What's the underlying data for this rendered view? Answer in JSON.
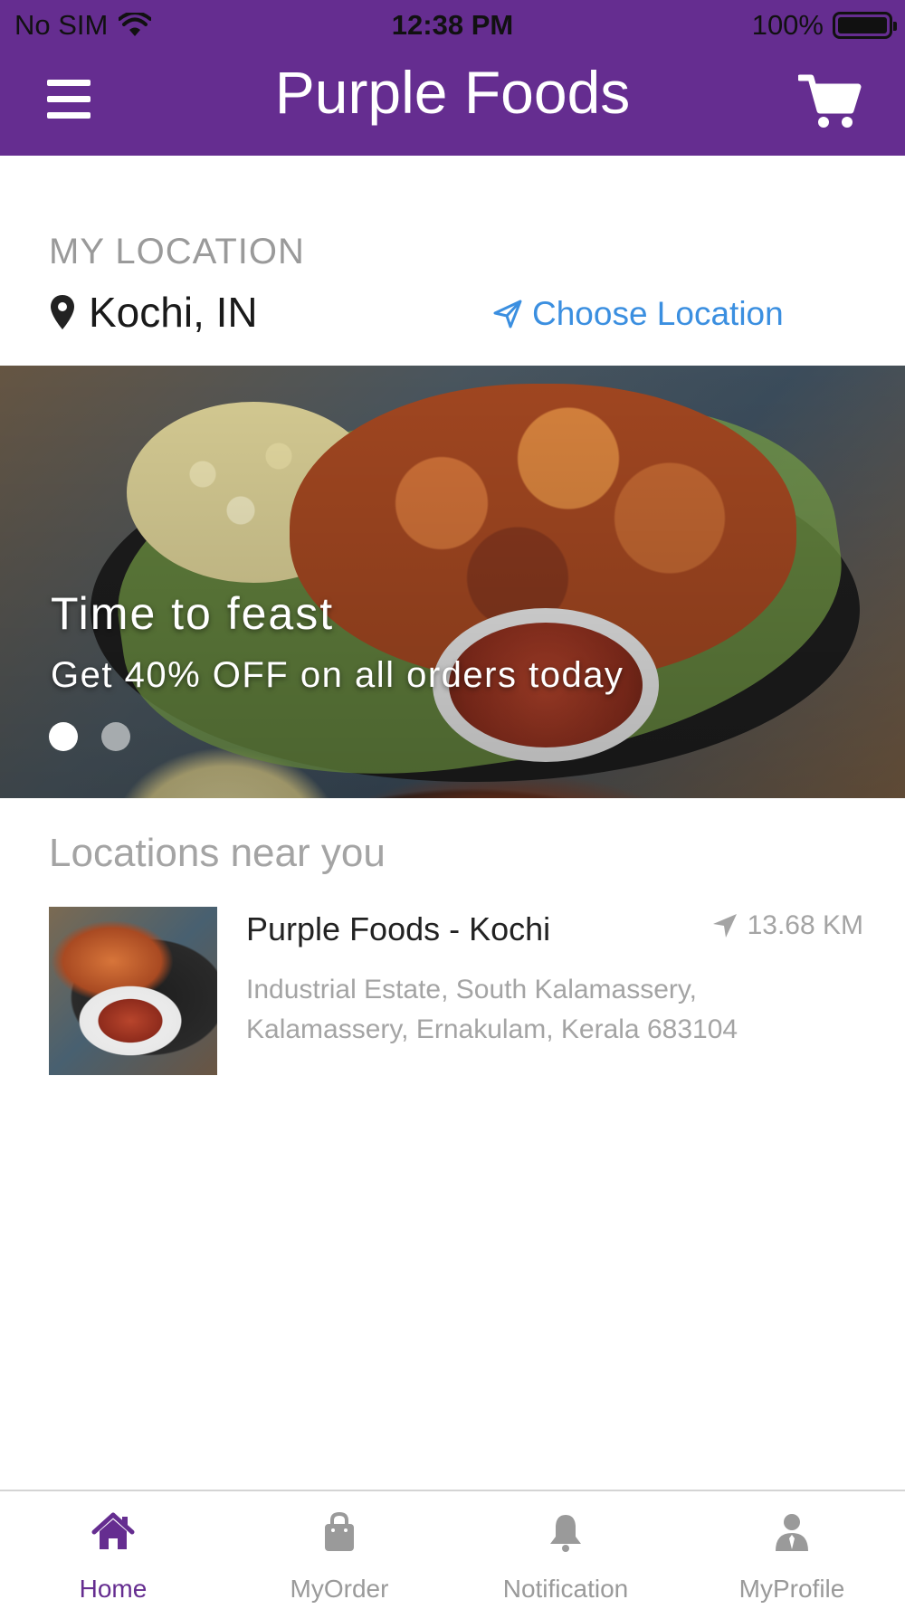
{
  "status_bar": {
    "carrier": "No SIM",
    "time": "12:38 PM",
    "battery": "100%"
  },
  "header": {
    "title": "Purple Foods",
    "menu_icon": "hamburger-menu-icon",
    "cart_icon": "shopping-cart-icon"
  },
  "location": {
    "caption": "MY LOCATION",
    "current": "Kochi, IN",
    "choose_label": "Choose Location"
  },
  "banner": {
    "headline": "Time to feast",
    "subline": "Get 40% OFF on all orders today",
    "slides": 2,
    "active_slide": 1
  },
  "nearby": {
    "title": "Locations near you",
    "stores": [
      {
        "name": "Purple Foods - Kochi",
        "distance": "13.68 KM",
        "address": "Industrial Estate, South Kalamassery, Kalamassery, Ernakulam, Kerala 683104"
      }
    ]
  },
  "tabs": [
    {
      "label": "Home",
      "icon": "home-icon",
      "active": true
    },
    {
      "label": "MyOrder",
      "icon": "shopping-bag-icon",
      "active": false
    },
    {
      "label": "Notification",
      "icon": "bell-icon",
      "active": false
    },
    {
      "label": "MyProfile",
      "icon": "user-profile-icon",
      "active": false
    }
  ],
  "colors": {
    "brand": "#652d90",
    "link": "#3b8fe0",
    "muted": "#a4a4a4",
    "inactive_tab": "#9a9a9a"
  }
}
